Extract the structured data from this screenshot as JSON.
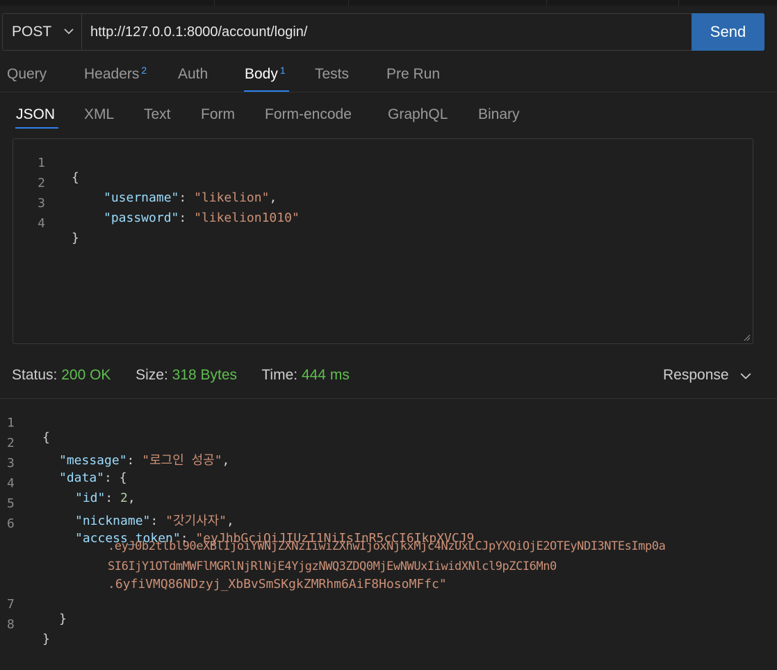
{
  "request": {
    "method": "POST",
    "url": "http://127.0.0.1:8000/account/login/",
    "send_label": "Send"
  },
  "request_tabs": [
    {
      "label": "Query"
    },
    {
      "label": "Headers",
      "badge": "2"
    },
    {
      "label": "Auth"
    },
    {
      "label": "Body",
      "badge": "1",
      "active": true
    },
    {
      "label": "Tests"
    },
    {
      "label": "Pre Run"
    }
  ],
  "body_tabs": [
    "JSON",
    "XML",
    "Text",
    "Form",
    "Form-encode",
    "GraphQL",
    "Binary"
  ],
  "body_active": "JSON",
  "request_body": {
    "line_numbers": [
      "1",
      "2",
      "3",
      "4"
    ],
    "open_brace": "{",
    "close_brace": "}",
    "username_key": "\"username\"",
    "username_value": "\"likelion\"",
    "password_key": "\"password\"",
    "password_value": "\"likelion1010\""
  },
  "status": {
    "status_label": "Status:",
    "status_value": "200 OK",
    "size_label": "Size:",
    "size_value": "318 Bytes",
    "time_label": "Time:",
    "time_value": "444 ms"
  },
  "response_dropdown": "Response",
  "response": {
    "line_numbers": [
      "1",
      "2",
      "3",
      "4",
      "5",
      "6",
      "7",
      "8"
    ],
    "message_key": "\"message\"",
    "message_value": "\"로그인 성공\"",
    "data_key": "\"data\"",
    "id_key": "\"id\"",
    "id_value": "2",
    "nickname_key": "\"nickname\"",
    "nickname_value": "\"갓기사자\"",
    "token_key": "\"access_token\"",
    "token_lines": [
      "\"eyJhbGciOiJIUzI1NiIsInR5cCI6IkpXVCJ9",
      ".eyJ0b2tlbl90eXBlIjoiYWNjZXNzIiwiZXhwIjoxNjkxMjc4NzUxLCJpYXQiOjE2OTEyNDI3NTEsImp0aSI6IjY1OTdmMWFlMGRlNjRlNjE4YjgzNWQ3ZDQ0MjEwNWUxIiwidXNlcl9pZCI6Mn0",
      ".6yfiVMQ86NDzyj_XbBvSmSKgkZMRhm6AiF8HosoMFfc\""
    ]
  }
}
